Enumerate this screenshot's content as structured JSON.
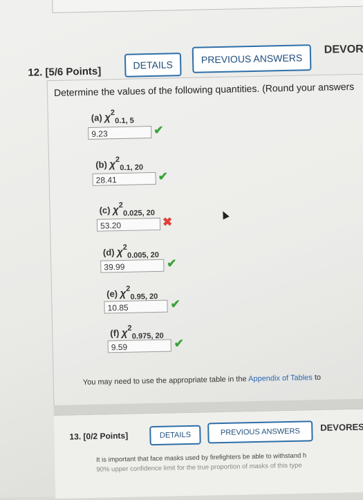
{
  "q12": {
    "header": "12.  [5/6 Points]",
    "details_label": "DETAILS",
    "previous_answers_label": "PREVIOUS ANSWERS",
    "devor_label": "DEVOR",
    "prompt": "Determine the values of the following quantities. (Round your answers",
    "parts": [
      {
        "label": "(a)",
        "chi": "χ",
        "sup": "2",
        "sub": "0.1, 5",
        "answer": "9.23",
        "status": "correct"
      },
      {
        "label": "(b)",
        "chi": "χ",
        "sup": "2",
        "sub": "0.1, 20",
        "answer": "28.41",
        "status": "correct"
      },
      {
        "label": "(c)",
        "chi": "χ",
        "sup": "2",
        "sub": "0.025, 20",
        "answer": "53.20",
        "status": "incorrect"
      },
      {
        "label": "(d)",
        "chi": "χ",
        "sup": "2",
        "sub": "0.005, 20",
        "answer": "39.99",
        "status": "correct"
      },
      {
        "label": "(e)",
        "chi": "χ",
        "sup": "2",
        "sub": "0.95, 20",
        "answer": "10.85",
        "status": "correct"
      },
      {
        "label": "(f)",
        "chi": "χ",
        "sup": "2",
        "sub": "0.975, 20",
        "answer": "9.59",
        "status": "correct"
      }
    ],
    "note_prefix": "You may need to use the appropriate table in the ",
    "note_link": "Appendix of Tables",
    "note_suffix": " to"
  },
  "marks": {
    "correct": "✔",
    "incorrect": "✖"
  },
  "q13": {
    "header": "13.  [0/2 Points]",
    "details_label": "DETAILS",
    "previous_answers_label": "PREVIOUS ANSWERS",
    "devor_label": "DEVORES",
    "text_line1": "It is important that face masks used by firefighters be able to withstand h",
    "text_line2": "90% upper confidence limit for the true proportion of masks of this type"
  },
  "colors": {
    "accent": "#2d6ea8",
    "correct": "#3aa23a",
    "incorrect": "#e0403a",
    "link": "#2a68b0"
  }
}
